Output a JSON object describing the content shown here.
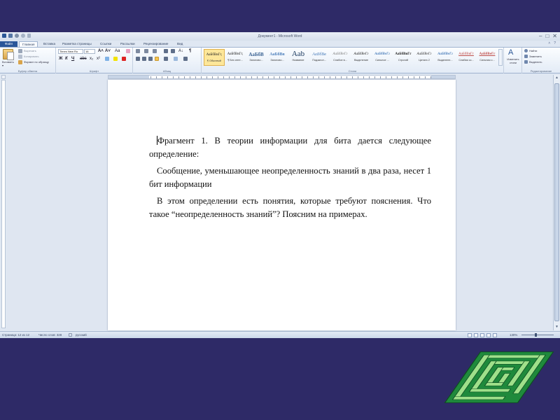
{
  "window": {
    "title": "Документ1 - Microsoft Word",
    "controls": [
      "–",
      "□",
      "✕"
    ]
  },
  "ribbon_tabs": [
    {
      "label": "Файл"
    },
    {
      "label": "Главная"
    },
    {
      "label": "Вставка"
    },
    {
      "label": "Разметка страницы"
    },
    {
      "label": "Ссылки"
    },
    {
      "label": "Рассылки"
    },
    {
      "label": "Рецензирование"
    },
    {
      "label": "Вид"
    }
  ],
  "clipboard": {
    "paste": "Вставить",
    "cut": "Вырезать",
    "copy": "Копировать",
    "format_painter": "Формат по образцу",
    "group": "Буфер обмена"
  },
  "font": {
    "name": "Times New Ro",
    "size": "16",
    "grow": "A˄",
    "shrink": "A˅",
    "case": "Aa",
    "bold": "Ж",
    "italic": "К",
    "underline": "Ч",
    "strike": "abc",
    "subscript": "x₂",
    "superscript": "x²",
    "group": "Шрифт"
  },
  "paragraph": {
    "group": "Абзац",
    "pilcrow": "¶",
    "sort": "А↓"
  },
  "styles": {
    "group": "Стили",
    "items": [
      {
        "sample": "АаБбВвГг,",
        "name": "¶ Обычный"
      },
      {
        "sample": "АаБбВвГг,",
        "name": "¶ Без инте..."
      },
      {
        "sample": "АаБбВ",
        "name": "Заголово..."
      },
      {
        "sample": "АаБбВв",
        "name": "Заголово..."
      },
      {
        "sample": "Aab",
        "name": "Название"
      },
      {
        "sample": "АаБбВв",
        "name": "Подзагол..."
      },
      {
        "sample": "АаБбВеГг",
        "name": "Слабое в..."
      },
      {
        "sample": "АаБбВеГг",
        "name": "Выделение"
      },
      {
        "sample": "АаБбВеГг",
        "name": "Сильное ..."
      },
      {
        "sample": "АаБбВвГг",
        "name": "Строгий"
      },
      {
        "sample": "АаБбВеГг",
        "name": "Цитата 2"
      },
      {
        "sample": "АаБбВеГг",
        "name": "Выделенн..."
      },
      {
        "sample": "АаБбВвГг",
        "name": "Слабая сс..."
      },
      {
        "sample": "АаБбВеГг",
        "name": "Сильная с..."
      }
    ],
    "change_styles": "Изменить стили"
  },
  "editing": {
    "find": "Найти",
    "replace": "Заменить",
    "select": "Выделить",
    "group": "Редактирование"
  },
  "document": {
    "paragraphs": [
      "Фрагмент 1. В теории информации для бита дается следующее определение:",
      "Сообщение, уменьшающее неопределенность знаний в два раза, несет 1 бит информации",
      "В этом определении есть понятия, которые требуют пояснения. Что такое “неопределенность знаний”? Поясним на примерах."
    ]
  },
  "status": {
    "page": "Страница: 12 из 12",
    "words": "Число слов: 328",
    "language": "русский",
    "zoom": "130%"
  },
  "colors": {
    "slide_background": "#2e2a67",
    "file_tab": "#2a5699",
    "maze_green": "#1f8a3c"
  },
  "decor": {
    "icon": "maze-icon"
  }
}
